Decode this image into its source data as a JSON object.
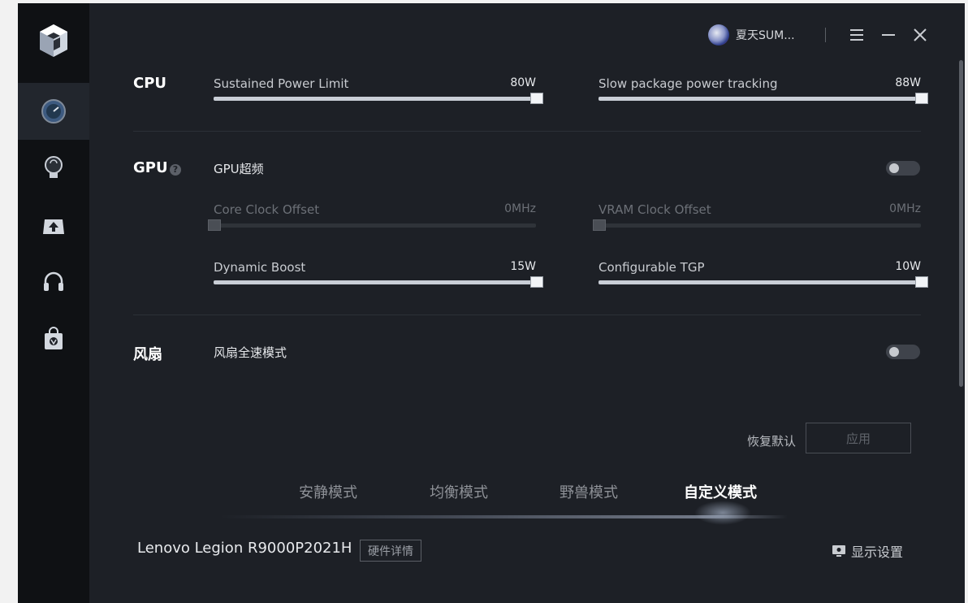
{
  "window": {
    "user_name": "夏天SUM...",
    "minimize_icon": "minimize-icon",
    "menu_icon": "menu-icon",
    "close_icon": "close-icon"
  },
  "sidebar": {
    "items": [
      {
        "icon": "speedometer-icon",
        "active": true
      },
      {
        "icon": "lightbulb-icon",
        "active": false
      },
      {
        "icon": "upload-icon",
        "active": false
      },
      {
        "icon": "headset-icon",
        "active": false
      },
      {
        "icon": "shopping-bag-icon",
        "active": false
      }
    ]
  },
  "cpu": {
    "section_label": "CPU",
    "sustained": {
      "label": "Sustained Power Limit",
      "value": "80W",
      "level": 1.0
    },
    "slow_package": {
      "label": "Slow package power tracking",
      "value": "88W",
      "level": 1.0
    }
  },
  "gpu": {
    "section_label": "GPU",
    "overclock_label": "GPU超频",
    "overclock_on": false,
    "core_clock": {
      "label": "Core Clock Offset",
      "value": "0MHz",
      "level": 0.0
    },
    "vram_clock": {
      "label": "VRAM Clock Offset",
      "value": "0MHz",
      "level": 0.0
    },
    "dynamic_boost": {
      "label": "Dynamic Boost",
      "value": "15W",
      "level": 1.0
    },
    "configurable_tgp": {
      "label": "Configurable TGP",
      "value": "10W",
      "level": 1.0
    }
  },
  "fan": {
    "section_label": "风扇",
    "full_speed_label": "风扇全速模式",
    "full_speed_on": false
  },
  "actions": {
    "restore_label": "恢复默认",
    "apply_label": "应用"
  },
  "modes": {
    "items": [
      "安静模式",
      "均衡模式",
      "野兽模式",
      "自定义模式"
    ],
    "active_index": 3
  },
  "footer": {
    "device_name": "Lenovo Legion R9000P2021H",
    "hardware_details_label": "硬件详情",
    "display_settings_label": "显示设置"
  }
}
